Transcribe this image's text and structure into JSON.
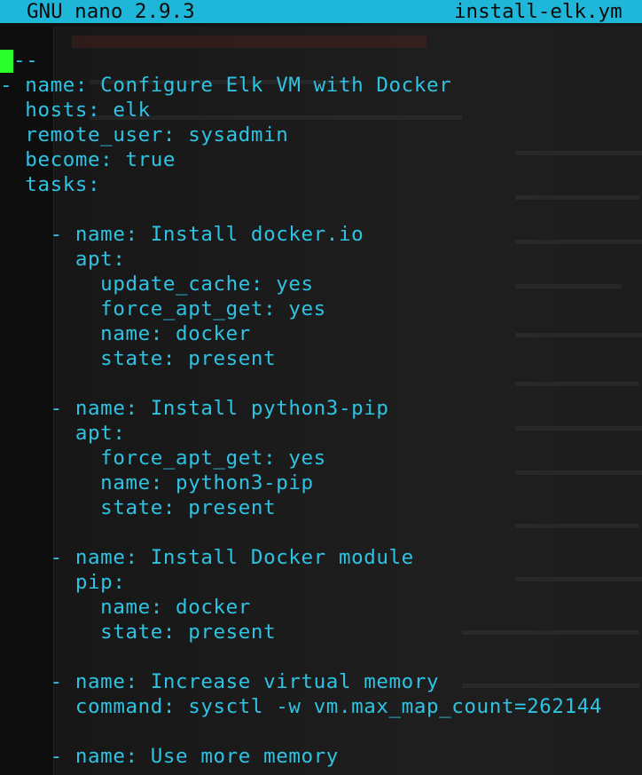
{
  "titlebar": {
    "app": "GNU nano 2.9.3",
    "filename": "install-elk.ym"
  },
  "editor": {
    "lines": [
      "--",
      "- name: Configure Elk VM with Docker",
      "  hosts: elk",
      "  remote_user: sysadmin",
      "  become: true",
      "  tasks:",
      "",
      "    - name: Install docker.io",
      "      apt:",
      "        update_cache: yes",
      "        force_apt_get: yes",
      "        name: docker",
      "        state: present",
      "",
      "    - name: Install python3-pip",
      "      apt:",
      "        force_apt_get: yes",
      "        name: python3-pip",
      "        state: present",
      "",
      "    - name: Install Docker module",
      "      pip:",
      "        name: docker",
      "        state: present",
      "",
      "    - name: Increase virtual memory",
      "      command: sysctl -w vm.max_map_count=262144",
      "",
      "    - name: Use more memory"
    ]
  },
  "colors": {
    "titlebar_bg": "#1fb7d9",
    "text": "#2fc3e3",
    "cursor": "#2bff2b"
  }
}
